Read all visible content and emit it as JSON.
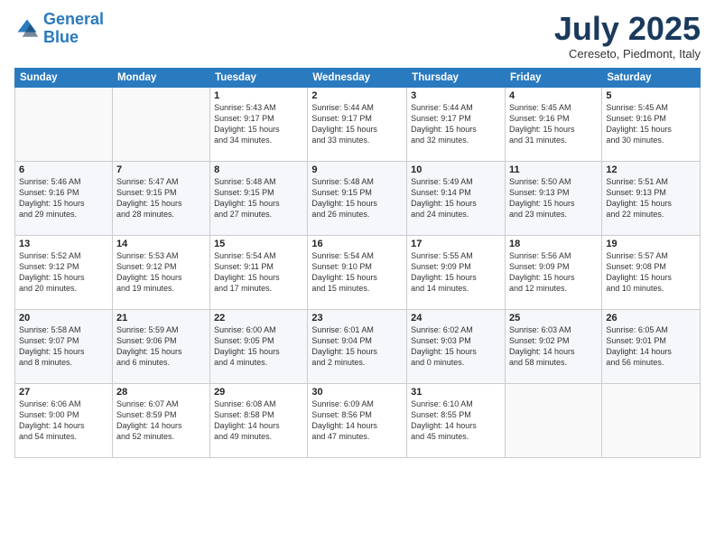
{
  "logo": {
    "line1": "General",
    "line2": "Blue"
  },
  "title": "July 2025",
  "subtitle": "Cereseto, Piedmont, Italy",
  "headers": [
    "Sunday",
    "Monday",
    "Tuesday",
    "Wednesday",
    "Thursday",
    "Friday",
    "Saturday"
  ],
  "weeks": [
    [
      {
        "num": "",
        "info": ""
      },
      {
        "num": "",
        "info": ""
      },
      {
        "num": "1",
        "info": "Sunrise: 5:43 AM\nSunset: 9:17 PM\nDaylight: 15 hours\nand 34 minutes."
      },
      {
        "num": "2",
        "info": "Sunrise: 5:44 AM\nSunset: 9:17 PM\nDaylight: 15 hours\nand 33 minutes."
      },
      {
        "num": "3",
        "info": "Sunrise: 5:44 AM\nSunset: 9:17 PM\nDaylight: 15 hours\nand 32 minutes."
      },
      {
        "num": "4",
        "info": "Sunrise: 5:45 AM\nSunset: 9:16 PM\nDaylight: 15 hours\nand 31 minutes."
      },
      {
        "num": "5",
        "info": "Sunrise: 5:45 AM\nSunset: 9:16 PM\nDaylight: 15 hours\nand 30 minutes."
      }
    ],
    [
      {
        "num": "6",
        "info": "Sunrise: 5:46 AM\nSunset: 9:16 PM\nDaylight: 15 hours\nand 29 minutes."
      },
      {
        "num": "7",
        "info": "Sunrise: 5:47 AM\nSunset: 9:15 PM\nDaylight: 15 hours\nand 28 minutes."
      },
      {
        "num": "8",
        "info": "Sunrise: 5:48 AM\nSunset: 9:15 PM\nDaylight: 15 hours\nand 27 minutes."
      },
      {
        "num": "9",
        "info": "Sunrise: 5:48 AM\nSunset: 9:15 PM\nDaylight: 15 hours\nand 26 minutes."
      },
      {
        "num": "10",
        "info": "Sunrise: 5:49 AM\nSunset: 9:14 PM\nDaylight: 15 hours\nand 24 minutes."
      },
      {
        "num": "11",
        "info": "Sunrise: 5:50 AM\nSunset: 9:13 PM\nDaylight: 15 hours\nand 23 minutes."
      },
      {
        "num": "12",
        "info": "Sunrise: 5:51 AM\nSunset: 9:13 PM\nDaylight: 15 hours\nand 22 minutes."
      }
    ],
    [
      {
        "num": "13",
        "info": "Sunrise: 5:52 AM\nSunset: 9:12 PM\nDaylight: 15 hours\nand 20 minutes."
      },
      {
        "num": "14",
        "info": "Sunrise: 5:53 AM\nSunset: 9:12 PM\nDaylight: 15 hours\nand 19 minutes."
      },
      {
        "num": "15",
        "info": "Sunrise: 5:54 AM\nSunset: 9:11 PM\nDaylight: 15 hours\nand 17 minutes."
      },
      {
        "num": "16",
        "info": "Sunrise: 5:54 AM\nSunset: 9:10 PM\nDaylight: 15 hours\nand 15 minutes."
      },
      {
        "num": "17",
        "info": "Sunrise: 5:55 AM\nSunset: 9:09 PM\nDaylight: 15 hours\nand 14 minutes."
      },
      {
        "num": "18",
        "info": "Sunrise: 5:56 AM\nSunset: 9:09 PM\nDaylight: 15 hours\nand 12 minutes."
      },
      {
        "num": "19",
        "info": "Sunrise: 5:57 AM\nSunset: 9:08 PM\nDaylight: 15 hours\nand 10 minutes."
      }
    ],
    [
      {
        "num": "20",
        "info": "Sunrise: 5:58 AM\nSunset: 9:07 PM\nDaylight: 15 hours\nand 8 minutes."
      },
      {
        "num": "21",
        "info": "Sunrise: 5:59 AM\nSunset: 9:06 PM\nDaylight: 15 hours\nand 6 minutes."
      },
      {
        "num": "22",
        "info": "Sunrise: 6:00 AM\nSunset: 9:05 PM\nDaylight: 15 hours\nand 4 minutes."
      },
      {
        "num": "23",
        "info": "Sunrise: 6:01 AM\nSunset: 9:04 PM\nDaylight: 15 hours\nand 2 minutes."
      },
      {
        "num": "24",
        "info": "Sunrise: 6:02 AM\nSunset: 9:03 PM\nDaylight: 15 hours\nand 0 minutes."
      },
      {
        "num": "25",
        "info": "Sunrise: 6:03 AM\nSunset: 9:02 PM\nDaylight: 14 hours\nand 58 minutes."
      },
      {
        "num": "26",
        "info": "Sunrise: 6:05 AM\nSunset: 9:01 PM\nDaylight: 14 hours\nand 56 minutes."
      }
    ],
    [
      {
        "num": "27",
        "info": "Sunrise: 6:06 AM\nSunset: 9:00 PM\nDaylight: 14 hours\nand 54 minutes."
      },
      {
        "num": "28",
        "info": "Sunrise: 6:07 AM\nSunset: 8:59 PM\nDaylight: 14 hours\nand 52 minutes."
      },
      {
        "num": "29",
        "info": "Sunrise: 6:08 AM\nSunset: 8:58 PM\nDaylight: 14 hours\nand 49 minutes."
      },
      {
        "num": "30",
        "info": "Sunrise: 6:09 AM\nSunset: 8:56 PM\nDaylight: 14 hours\nand 47 minutes."
      },
      {
        "num": "31",
        "info": "Sunrise: 6:10 AM\nSunset: 8:55 PM\nDaylight: 14 hours\nand 45 minutes."
      },
      {
        "num": "",
        "info": ""
      },
      {
        "num": "",
        "info": ""
      }
    ]
  ]
}
